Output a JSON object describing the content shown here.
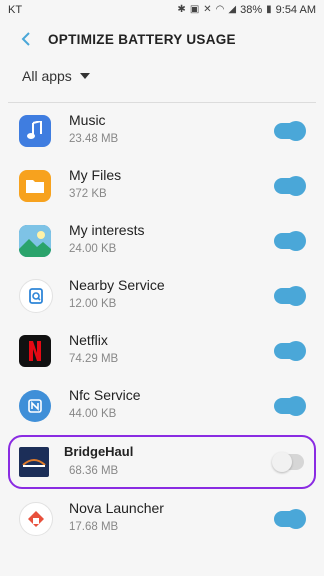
{
  "status_bar": {
    "carrier": "KT",
    "battery": "38%",
    "time": "9:54 AM"
  },
  "header": {
    "title": "OPTIMIZE BATTERY USAGE"
  },
  "filter": {
    "label": "All apps"
  },
  "apps": [
    {
      "name": "Music",
      "size": "23.48 MB",
      "enabled": true
    },
    {
      "name": "My Files",
      "size": "372 KB",
      "enabled": true
    },
    {
      "name": "My interests",
      "size": "24.00 KB",
      "enabled": true
    },
    {
      "name": "Nearby Service",
      "size": "12.00 KB",
      "enabled": true
    },
    {
      "name": "Netflix",
      "size": "74.29 MB",
      "enabled": true
    },
    {
      "name": "Nfc Service",
      "size": "44.00 KB",
      "enabled": true
    },
    {
      "name": "BridgeHaul",
      "size": "68.36 MB",
      "enabled": false
    },
    {
      "name": "Nova Launcher",
      "size": "17.68 MB",
      "enabled": true
    }
  ],
  "colors": {
    "accent": "#4aa7d8",
    "highlight": "#8a2be2"
  }
}
